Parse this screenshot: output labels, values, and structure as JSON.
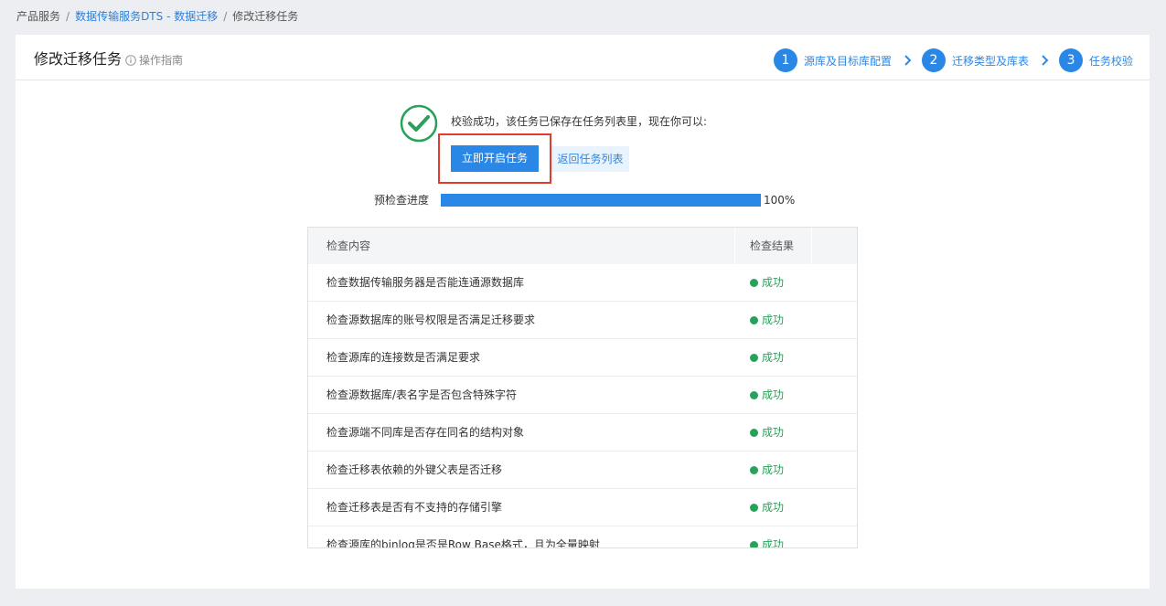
{
  "breadcrumb": {
    "items": [
      "产品服务",
      "数据传输服务DTS - 数据迁移",
      "修改迁移任务"
    ],
    "separator": "/"
  },
  "header": {
    "title": "修改迁移任务",
    "guide": "操作指南"
  },
  "steps": [
    {
      "num": "1",
      "label": "源库及目标库配置"
    },
    {
      "num": "2",
      "label": "迁移类型及库表"
    },
    {
      "num": "3",
      "label": "任务校验"
    }
  ],
  "result": {
    "message": "校验成功，该任务已保存在任务列表里，现在你可以:",
    "start_button": "立即开启任务",
    "back_button": "返回任务列表"
  },
  "progress": {
    "label": "预检查进度",
    "value": 100,
    "text": "100%"
  },
  "table": {
    "headers": [
      "检查内容",
      "检查结果"
    ],
    "rows": [
      {
        "item": "检查数据传输服务器是否能连通源数据库",
        "status": "成功"
      },
      {
        "item": "检查源数据库的账号权限是否满足迁移要求",
        "status": "成功"
      },
      {
        "item": "检查源库的连接数是否满足要求",
        "status": "成功"
      },
      {
        "item": "检查源数据库/表名字是否包含特殊字符",
        "status": "成功"
      },
      {
        "item": "检查源端不同库是否存在同名的结构对象",
        "status": "成功"
      },
      {
        "item": "检查迁移表依赖的外键父表是否迁移",
        "status": "成功"
      },
      {
        "item": "检查迁移表是否有不支持的存储引擎",
        "status": "成功"
      },
      {
        "item": "检查源库的binlog是否是Row Base格式，且为全量映射",
        "status": "成功"
      }
    ]
  },
  "colors": {
    "primary": "#2b87e6",
    "success": "#2aa15a",
    "highlight": "#e23b2e"
  }
}
